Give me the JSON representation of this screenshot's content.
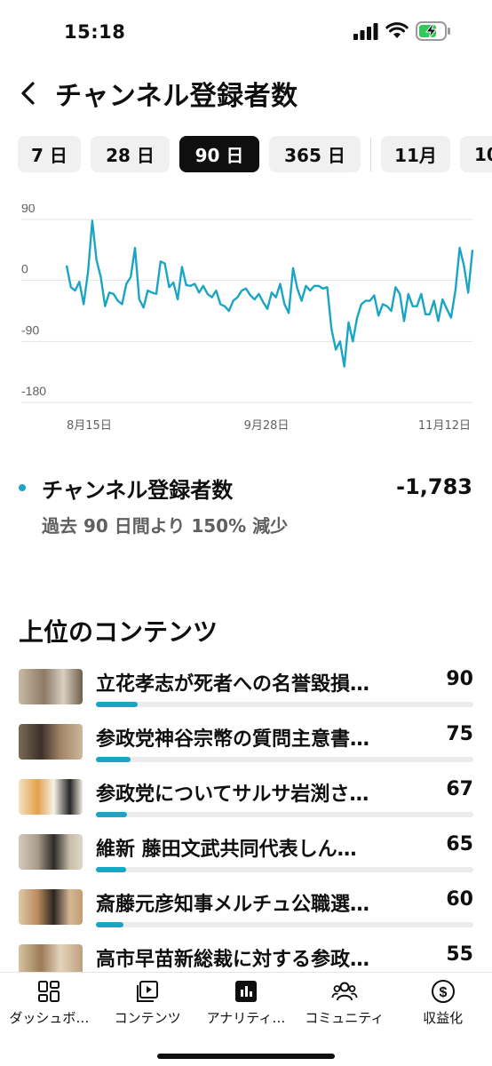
{
  "status_bar": {
    "time": "15:18"
  },
  "header": {
    "title": "チャンネル登録者数"
  },
  "range_chips": [
    {
      "label": "7 日",
      "selected": false
    },
    {
      "label": "28 日",
      "selected": false
    },
    {
      "label": "90 日",
      "selected": true
    },
    {
      "label": "365 日",
      "selected": false
    },
    {
      "label": "11月",
      "selected": false
    },
    {
      "label": "10",
      "selected": false
    }
  ],
  "chart_data": {
    "type": "line",
    "y_ticks": [
      "90",
      "0",
      "-90",
      "-180"
    ],
    "ylim": [
      -180,
      90
    ],
    "x_tick_labels": [
      "8月15日",
      "9月28日",
      "11月12日"
    ],
    "grid": true,
    "color": "#1aa5c5",
    "values": [
      22,
      -10,
      -15,
      -2,
      -35,
      12,
      88,
      30,
      5,
      -38,
      -18,
      -20,
      -30,
      -35,
      -5,
      5,
      48,
      -28,
      -40,
      -15,
      -18,
      -20,
      28,
      25,
      -10,
      -3,
      -28,
      20,
      -7,
      -8,
      -5,
      -18,
      -8,
      -20,
      -25,
      -15,
      -35,
      -38,
      -45,
      -30,
      -25,
      -15,
      -12,
      -22,
      -28,
      -20,
      -32,
      -42,
      -18,
      -25,
      -5,
      -35,
      -48,
      18,
      -12,
      -30,
      -8,
      -15,
      -8,
      -8,
      -12,
      -10,
      -72,
      -102,
      -90,
      -127,
      -62,
      -90,
      -55,
      -35,
      -30,
      -30,
      -22,
      -52,
      -35,
      -38,
      -45,
      -10,
      -20,
      -60,
      -20,
      -38,
      -38,
      -20,
      -50,
      -50,
      -30,
      -60,
      -28,
      -42,
      -55,
      -15,
      48,
      22,
      -18,
      45
    ]
  },
  "metric": {
    "label": "チャンネル登録者数",
    "value": "-1,783",
    "comparison": "過去 90 日間より 150% 減少",
    "accent": "#1aa5c5"
  },
  "top_content": {
    "title": "上位のコンテンツ",
    "items": [
      {
        "title": "立花孝志が死者への名誉毀損…",
        "views": "90"
      },
      {
        "title": "参政党神谷宗幣の質問主意書…",
        "views": "75"
      },
      {
        "title": "参政党についてサルサ岩渕さ…",
        "views": "67"
      },
      {
        "title": "維新 藤田文武共同代表しん…",
        "views": "65"
      },
      {
        "title": "斎藤元彦知事メルチュ公職選…",
        "views": "60"
      },
      {
        "title": "高市早苗新総裁に対する参政…",
        "views": "55"
      }
    ]
  },
  "bottom_nav": {
    "items": [
      {
        "label": "ダッシュボ…",
        "icon": "dashboard-icon"
      },
      {
        "label": "コンテンツ",
        "icon": "content-icon"
      },
      {
        "label": "アナリティ…",
        "icon": "analytics-icon"
      },
      {
        "label": "コミュニティ",
        "icon": "community-icon"
      },
      {
        "label": "収益化",
        "icon": "monetization-icon"
      }
    ]
  }
}
